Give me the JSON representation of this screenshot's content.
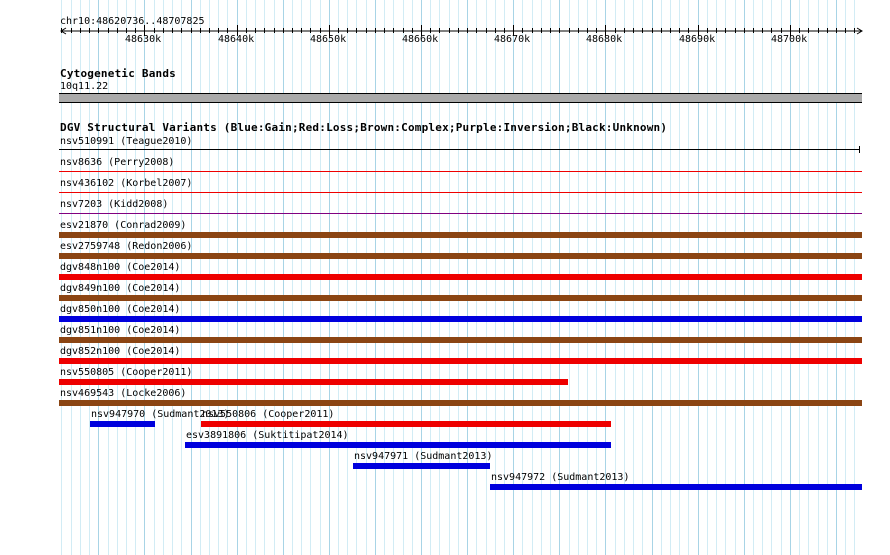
{
  "ruler": {
    "range_label": "chr10:48620736..48707825",
    "start": 48620736,
    "end": 48707825,
    "ticks": [
      "48630k",
      "48640k",
      "48650k",
      "48660k",
      "48670k",
      "48680k",
      "48690k",
      "48700k"
    ]
  },
  "cyto": {
    "title": "Cytogenetic Bands",
    "band_label": "10q11.22"
  },
  "dgv": {
    "title": "DGV Structural Variants (Blue:Gain;Red:Loss;Brown:Complex;Purple:Inversion;Black:Unknown)",
    "colors": {
      "gain": "#0000dd",
      "loss": "#ee0000",
      "complex": "#8b4513",
      "inversion": "#800080",
      "unknown": "#000000"
    },
    "features": [
      {
        "label": "nsv510991 (Teague2010)",
        "type": "unknown",
        "start": 48620736,
        "end": 48707600,
        "style": "line"
      },
      {
        "label": "nsv8636 (Perry2008)",
        "type": "loss",
        "start": 48620736,
        "end": 48707825,
        "style": "hair"
      },
      {
        "label": "nsv436102 (Korbel2007)",
        "type": "loss",
        "start": 48620736,
        "end": 48707825,
        "style": "hair"
      },
      {
        "label": "nsv7203 (Kidd2008)",
        "type": "inversion",
        "start": 48620736,
        "end": 48707825,
        "style": "hair"
      },
      {
        "label": "esv21870 (Conrad2009)",
        "type": "complex",
        "start": 48620736,
        "end": 48707825,
        "style": "thick"
      },
      {
        "label": "esv2759748 (Redon2006)",
        "type": "complex",
        "start": 48620736,
        "end": 48707825,
        "style": "thick"
      },
      {
        "label": "dgv848n100 (Coe2014)",
        "type": "loss",
        "start": 48620736,
        "end": 48707825,
        "style": "thick"
      },
      {
        "label": "dgv849n100 (Coe2014)",
        "type": "complex",
        "start": 48620736,
        "end": 48707825,
        "style": "thick"
      },
      {
        "label": "dgv850n100 (Coe2014)",
        "type": "gain",
        "start": 48620736,
        "end": 48707825,
        "style": "thick"
      },
      {
        "label": "dgv851n100 (Coe2014)",
        "type": "complex",
        "start": 48620736,
        "end": 48707825,
        "style": "thick"
      },
      {
        "label": "dgv852n100 (Coe2014)",
        "type": "loss",
        "start": 48620736,
        "end": 48707825,
        "style": "thick"
      },
      {
        "label": "nsv550805 (Cooper2011)",
        "type": "loss",
        "start": 48620736,
        "end": 48675900,
        "style": "thick"
      },
      {
        "label": "nsv469543 (Locke2006)",
        "type": "complex",
        "start": 48620736,
        "end": 48707825,
        "style": "thick"
      },
      {
        "label": "nsv947970 (Sudmant2013)",
        "type": "gain",
        "start": 48624100,
        "end": 48631200,
        "style": "thick"
      },
      {
        "label": "nsv550806 (Cooper2011)",
        "type": "loss",
        "start": 48636100,
        "end": 48680600,
        "style": "thick"
      },
      {
        "label": "esv3891806 (Suktitipat2014)",
        "type": "gain",
        "start": 48634400,
        "end": 48680600,
        "style": "thick"
      },
      {
        "label": "nsv947971 (Sudmant2013)",
        "type": "gain",
        "start": 48652600,
        "end": 48667500,
        "style": "thick"
      },
      {
        "label": "nsv947972 (Sudmant2013)",
        "type": "gain",
        "start": 48667500,
        "end": 48707825,
        "style": "thick"
      }
    ]
  }
}
